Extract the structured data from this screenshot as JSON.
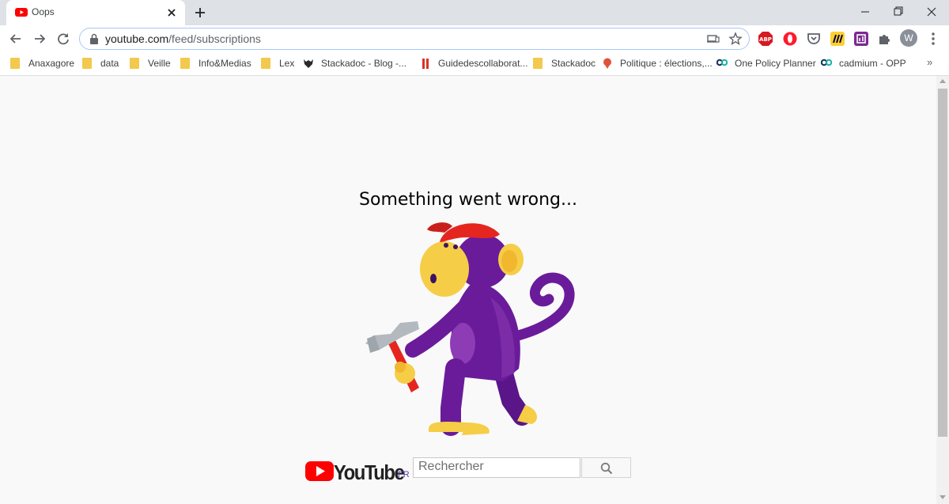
{
  "browser": {
    "tab": {
      "title": "Oops",
      "favicon": "youtube-icon"
    },
    "toolbar": {
      "url_host": "youtube.com",
      "url_path": "/feed/subscriptions",
      "extensions": [
        "abp-icon",
        "opera-icon",
        "pocket-icon",
        "miro-icon",
        "extension-purple-icon",
        "puzzle-icon"
      ],
      "profile_initial": "W"
    },
    "bookmarks": [
      {
        "label": "Anaxagore",
        "icon": "folder-icon"
      },
      {
        "label": "data",
        "icon": "folder-icon"
      },
      {
        "label": "Veille",
        "icon": "folder-icon"
      },
      {
        "label": "Info&Medias",
        "icon": "folder-icon"
      },
      {
        "label": "Lex",
        "icon": "folder-icon"
      },
      {
        "label": "Stackadoc - Blog -...",
        "icon": "fox-icon"
      },
      {
        "label": "Guidedescollaborat...",
        "icon": "red-bars-icon"
      },
      {
        "label": "Stackadoc",
        "icon": "folder-icon"
      },
      {
        "label": "Politique : élections,...",
        "icon": "pin-icon"
      },
      {
        "label": "One Policy Planner",
        "icon": "opp-icon"
      },
      {
        "label": "cadmium - OPP",
        "icon": "opp-icon"
      }
    ],
    "bookmarks_more": "»"
  },
  "page": {
    "error_title": "Something went wrong...",
    "illustration": "monkey-with-hammer",
    "logo_country": "FR",
    "search_placeholder": "Rechercher"
  },
  "colors": {
    "youtube_red": "#ff0000",
    "monkey_purple": "#6a1b9a",
    "monkey_yellow": "#f5cd47",
    "cap_red": "#e52620"
  }
}
